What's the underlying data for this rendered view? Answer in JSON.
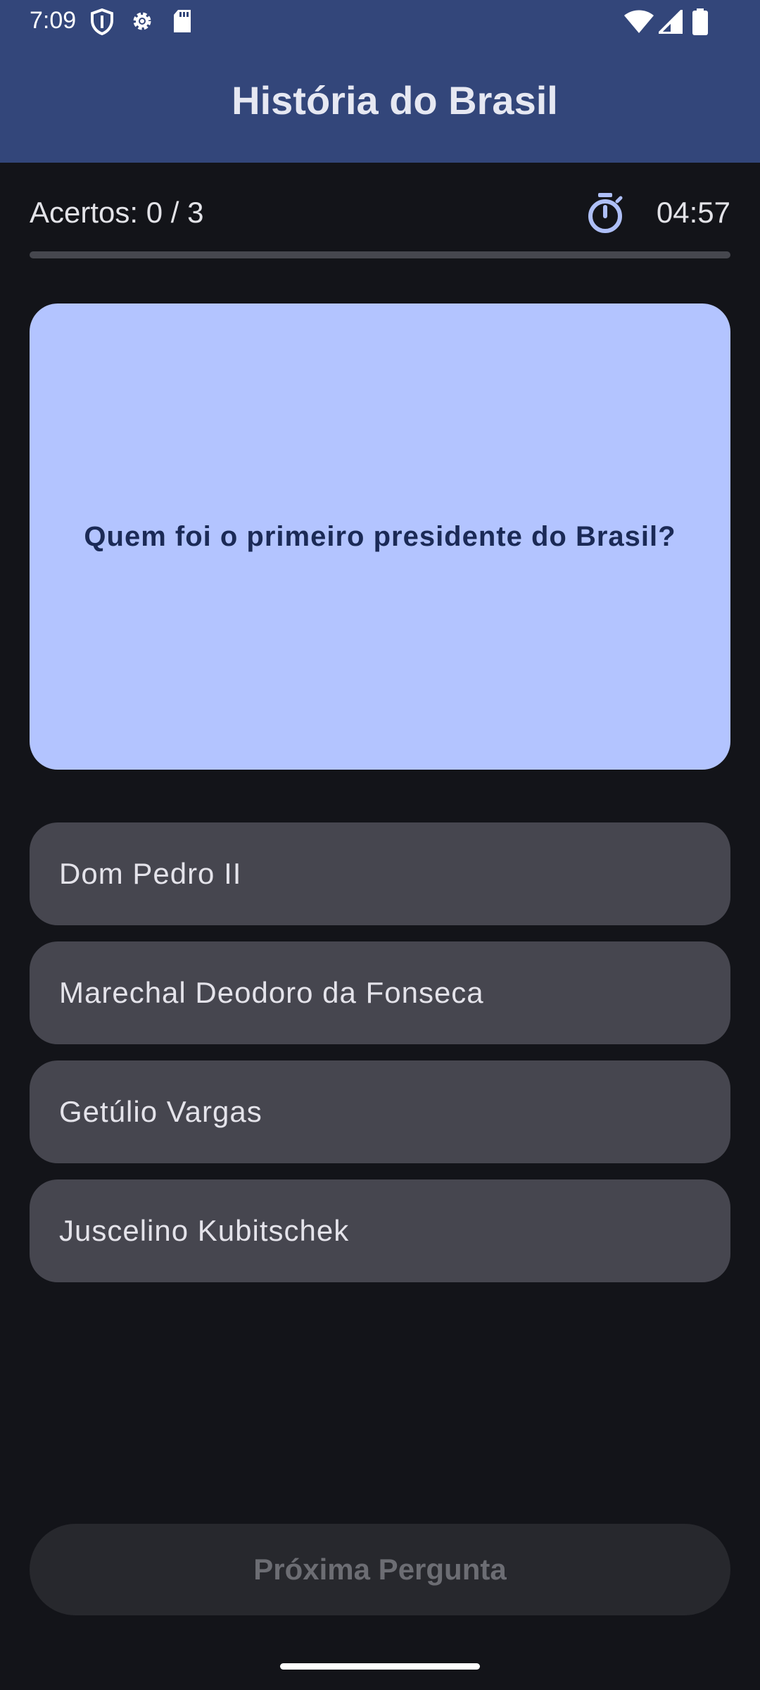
{
  "status_bar": {
    "time": "7:09",
    "left_icons": [
      "shield-icon",
      "gear-icon",
      "sd-card-icon"
    ],
    "right_icons": [
      "wifi-icon",
      "cell-signal-icon",
      "battery-icon"
    ]
  },
  "app_bar": {
    "title": "História do Brasil"
  },
  "score": {
    "label": "Acertos: 0 / 3",
    "timer_icon": "stopwatch-icon",
    "timer": "04:57",
    "progress_fraction": 0
  },
  "question": {
    "text": "Quem foi o primeiro presidente do Brasil?"
  },
  "answers": [
    {
      "label": "Dom Pedro II"
    },
    {
      "label": "Marechal Deodoro da Fonseca"
    },
    {
      "label": "Getúlio Vargas"
    },
    {
      "label": "Juscelino Kubitschek"
    }
  ],
  "next_button": {
    "label": "Próxima Pergunta",
    "enabled": false
  },
  "colors": {
    "app_bar": "#33467a",
    "background": "#131419",
    "question_card": "#b3c4ff",
    "answer_card": "#46464f",
    "disabled_button": "#27282d"
  }
}
